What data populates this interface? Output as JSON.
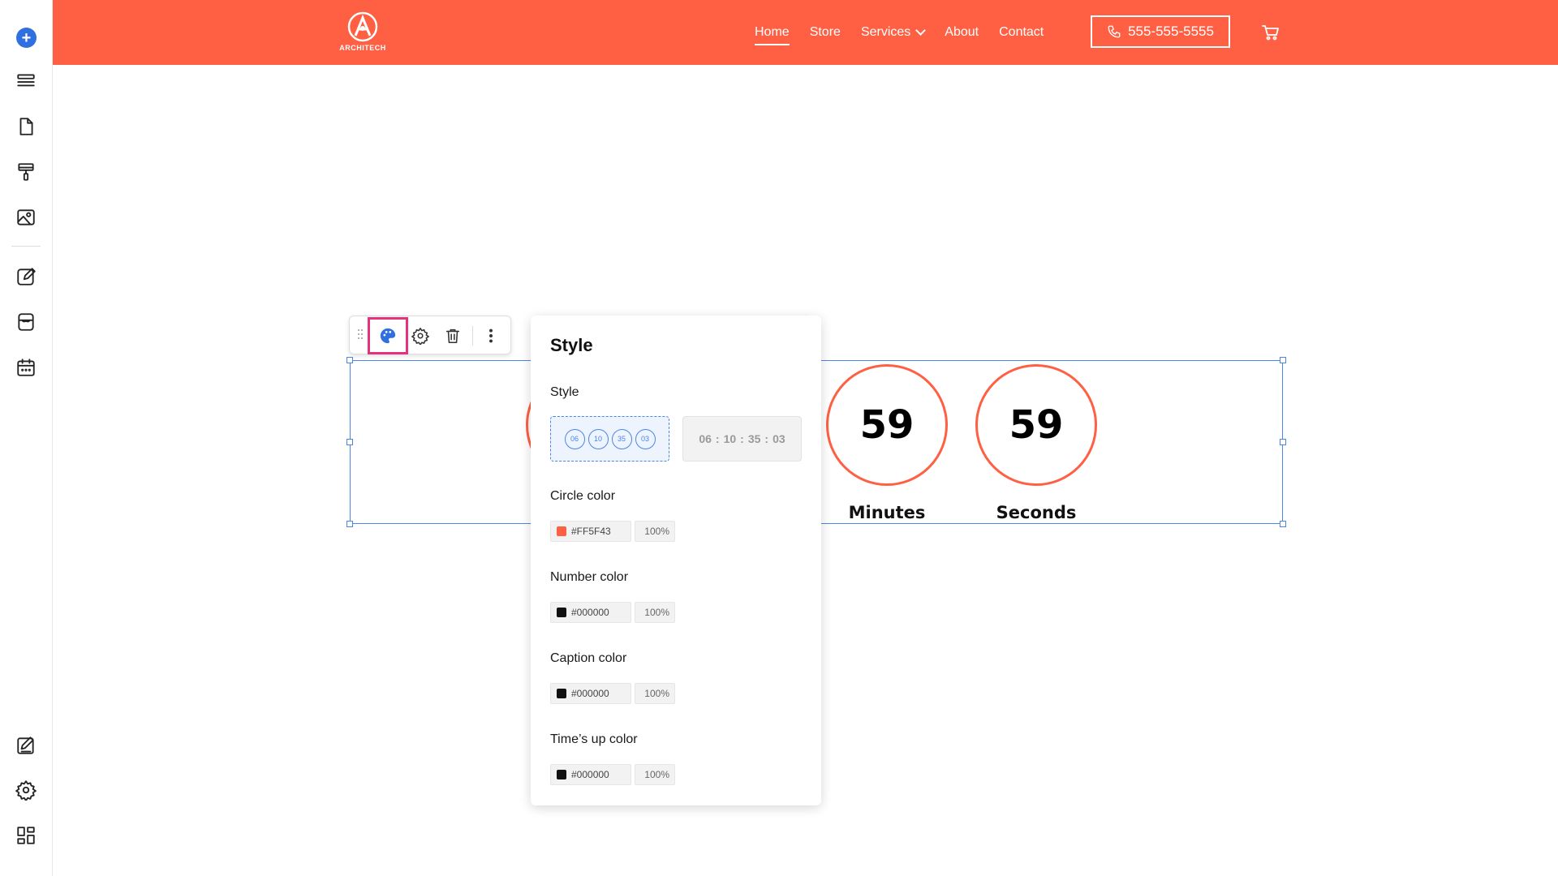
{
  "sidebar": {
    "add_icon": "plus-icon",
    "icons": [
      "layers-icon",
      "page-icon",
      "paint-roller-icon",
      "image-icon",
      "edit-icon",
      "store-icon",
      "calendar-icon",
      "design-icon",
      "settings-icon",
      "apps-icon"
    ]
  },
  "header": {
    "brand_color": "#FF5F43",
    "logo_text": "ARCHITECH",
    "nav": [
      {
        "label": "Home",
        "active": true
      },
      {
        "label": "Store"
      },
      {
        "label": "Services",
        "dropdown": true
      },
      {
        "label": "About"
      },
      {
        "label": "Contact"
      }
    ],
    "phone": "555-555-5555",
    "cart_icon": "cart-icon"
  },
  "countdown": {
    "units": [
      {
        "value": "59",
        "caption": "Minutes"
      },
      {
        "value": "59",
        "caption": "Seconds"
      }
    ]
  },
  "toolbar": {
    "icons": [
      "drag-handle-icon",
      "palette-icon",
      "gear-icon",
      "trash-icon",
      "more-vertical-icon"
    ]
  },
  "style_panel": {
    "title": "Style",
    "style_label": "Style",
    "style_circles": [
      "06",
      "10",
      "35",
      "03"
    ],
    "style_flat": [
      "06",
      "10",
      "35",
      "03"
    ],
    "circle_color": {
      "label": "Circle color",
      "hex": "#FF5F43",
      "opacity": "100%"
    },
    "number_color": {
      "label": "Number color",
      "hex": "#000000",
      "opacity": "100%"
    },
    "caption_color": {
      "label": "Caption color",
      "hex": "#000000",
      "opacity": "100%"
    },
    "times_up_color": {
      "label": "Time’s up color",
      "hex": "#000000",
      "opacity": "100%"
    }
  }
}
